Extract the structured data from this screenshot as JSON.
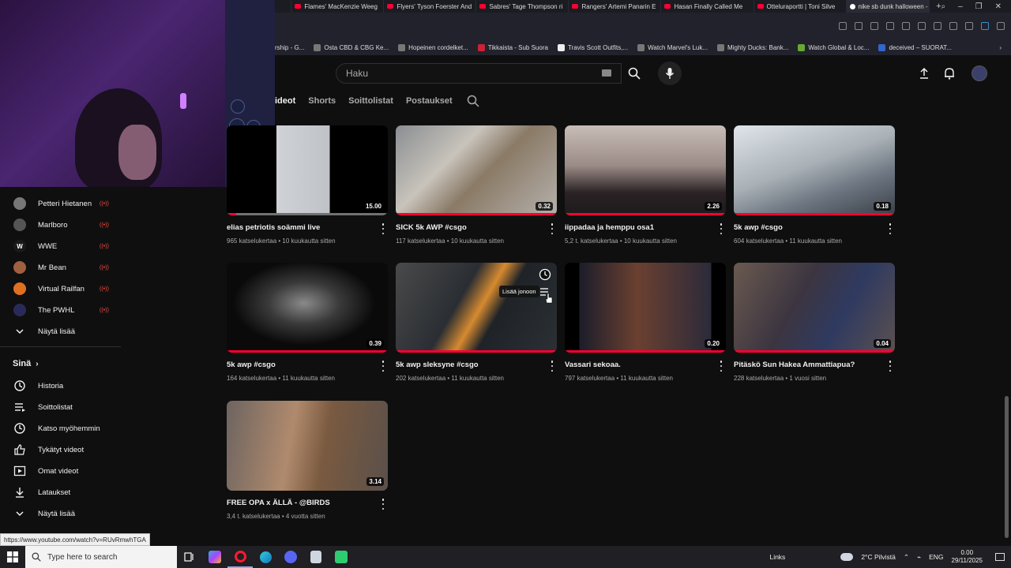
{
  "browser": {
    "tabs": [
      {
        "label": ""
      },
      {
        "label": "Flames' MacKenzie Weeg"
      },
      {
        "label": "Flyers' Tyson Foerster And"
      },
      {
        "label": "Sabres' Tage Thompson ri"
      },
      {
        "label": "Rangers' Artemi Panarin E"
      },
      {
        "label": "Hasan Finally Called Me"
      },
      {
        "label": "Otteluraportti | Toni Silve"
      },
      {
        "label": "nike sb dunk halloween -"
      }
    ],
    "bookmarks": [
      "rship - G...",
      "Osta CBD & CBG Ke...",
      "Hopeinen cordelket...",
      "Tikkaista - Sub Suora",
      "Travis Scott Outfits,...",
      "Watch Marvel's Luk...",
      "Mighty Ducks: Bank...",
      "Watch Global & Loc...",
      "deceived – SUORAT..."
    ]
  },
  "header": {
    "search_placeholder": "Haku"
  },
  "channel_tabs": [
    "ideot",
    "Shorts",
    "Soittolistat",
    "Postaukset"
  ],
  "sidebar": {
    "subscriptions": [
      {
        "name": "Petteri Hietanen",
        "color": "#777777"
      },
      {
        "name": "Marlboro",
        "color": "#555555"
      },
      {
        "name": "WWE",
        "color": "#1a1a1a"
      },
      {
        "name": "Mr Bean",
        "color": "#a06040"
      },
      {
        "name": "Virtual Railfan",
        "color": "#e07020"
      },
      {
        "name": "The PWHL",
        "color": "#2a2a5a"
      }
    ],
    "show_more_1": "Näytä lisää",
    "you_heading": "Sinä",
    "you_items": [
      {
        "label": "Historia",
        "icon": "history-icon"
      },
      {
        "label": "Soittolistat",
        "icon": "playlists-icon"
      },
      {
        "label": "Katso myöhemmin",
        "icon": "watch-later-icon"
      },
      {
        "label": "Tykätyt videot",
        "icon": "like-icon"
      },
      {
        "label": "Omat videot",
        "icon": "your-videos-icon"
      },
      {
        "label": "Lataukset",
        "icon": "downloads-icon"
      }
    ],
    "show_more_2": "Näytä lisää"
  },
  "videos": [
    {
      "title": "elias petriotis soämmi live",
      "meta": "965 katselukertaa • 10 kuukautta sitten",
      "duration": "15.00",
      "bg": "linear-gradient(90deg,#000 0%,#000 31%,#cfd2d6 31%,#bfc3c8 64%,#000 64%)",
      "watched": "partial"
    },
    {
      "title": "SICK 5k AWP #csgo",
      "meta": "117 katselukertaa • 10 kuukautta sitten",
      "duration": "0.32",
      "bg": "linear-gradient(135deg,#8a8e92 0%,#c8c3bb 35%,#8a7a66 55%,#b5b1ac 100%)",
      "watched": "full"
    },
    {
      "title": "iippadaa ja hemppu osa1",
      "meta": "5,2 t. katselukertaa • 10 kuukautta sitten",
      "duration": "2.26",
      "bg": "linear-gradient(180deg,#c8bdb8 0%,#9a8a85 45%,#2a2224 75%,#1d1a1c 100%)",
      "watched": "full"
    },
    {
      "title": "5k awp #csgo",
      "meta": "604 katselukertaa • 11 kuukautta sitten",
      "duration": "0.18",
      "bg": "linear-gradient(160deg,#dfe5ea 0%,#a9b0b6 45%,#6c7580 70%,#3a3f48 100%)",
      "watched": "full"
    },
    {
      "title": "5k awp #csgo",
      "meta": "164 katselukertaa • 11 kuukautta sitten",
      "duration": "0.39",
      "bg": "radial-gradient(ellipse at 48% 45%,#8a8a8a 0%,#3a3a3a 30%,#0a0a0a 60%)",
      "watched": "full"
    },
    {
      "title": "5k awp sleksyne #csgo",
      "meta": "202 katselukertaa • 11 kuukautta sitten",
      "duration": "",
      "bg": "linear-gradient(120deg,#4a4a4a 0%,#2a2e33 40%,#d68a30 52%,#1f2328 62%,#2b3034 100%)",
      "watched": "full"
    },
    {
      "title": "Vassari sekoaa.",
      "meta": "797 katselukertaa • 11 kuukautta sitten",
      "duration": "0.20",
      "bg": "linear-gradient(90deg,#000 0%,#000 9%,#1b1d2a 9%,#6b4030 45%,#2b2a3a 91%,#000 91%)",
      "watched": "full"
    },
    {
      "title": "Pitäskö Sun Hakea Ammattiapua?",
      "meta": "228 katselukertaa • 1 vuosi sitten",
      "duration": "0.04",
      "bg": "linear-gradient(120deg,#6a5a50 0%,#3c3540 40%,#2f3a60 65%,#5b5050 100%)",
      "watched": "full"
    },
    {
      "title": "FREE OPA x ÄLLÄ - @BIRDS",
      "meta": "3,4 t. katselukertaa • 4 vuotta sitten",
      "duration": "3.14",
      "bg": "linear-gradient(100deg,#6d6460 0%,#b08a6d 40%,#7a5a40 60%,#5a504a 100%)",
      "watched": "none"
    }
  ],
  "hover": {
    "tooltip": "Lisää jonoon"
  },
  "status_url": "https://www.youtube.com/watch?v=RUvRmwhTGA",
  "taskbar": {
    "search_placeholder": "Type here to search",
    "links": "Links",
    "weather": "2°C  Pilvistä",
    "lang": "ENG",
    "time": "0.00",
    "date": "29/11/2025"
  },
  "colors": {
    "accent": "#ff0033",
    "bg": "#0f0f0f"
  }
}
